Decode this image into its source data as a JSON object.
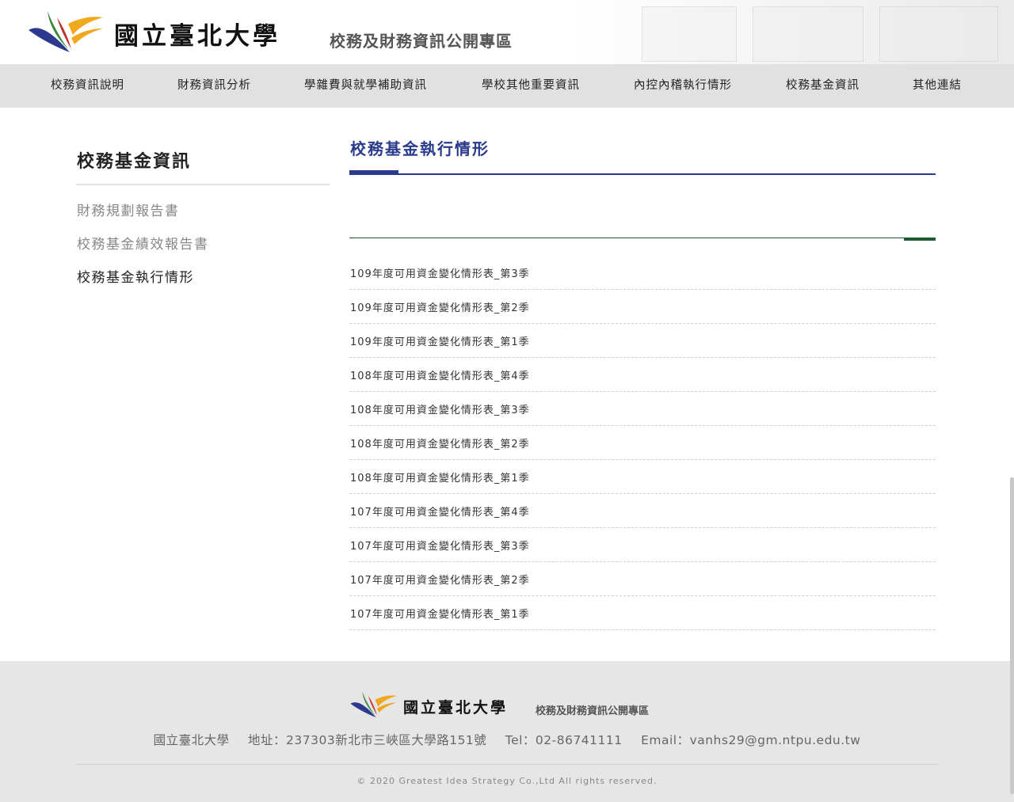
{
  "header": {
    "brand_name": "國立臺北大學",
    "brand_sub": "校務及財務資訊公開專區"
  },
  "nav": {
    "items": [
      {
        "label": "校務資訊說明"
      },
      {
        "label": "財務資訊分析"
      },
      {
        "label": "學雜費與就學補助資訊"
      },
      {
        "label": "學校其他重要資訊"
      },
      {
        "label": "內控內稽執行情形"
      },
      {
        "label": "校務基金資訊"
      },
      {
        "label": "其他連結"
      }
    ]
  },
  "sidebar": {
    "title": "校務基金資訊",
    "items": [
      {
        "label": "財務規劃報告書",
        "active": false
      },
      {
        "label": "校務基金績效報告書",
        "active": false
      },
      {
        "label": "校務基金執行情形",
        "active": true
      }
    ]
  },
  "main": {
    "title": "校務基金執行情形",
    "documents": [
      "109年度可用資金變化情形表_第3季",
      "109年度可用資金變化情形表_第2季",
      "109年度可用資金變化情形表_第1季",
      "108年度可用資金變化情形表_第4季",
      "108年度可用資金變化情形表_第3季",
      "108年度可用資金變化情形表_第2季",
      "108年度可用資金變化情形表_第1季",
      "107年度可用資金變化情形表_第4季",
      "107年度可用資金變化情形表_第3季",
      "107年度可用資金變化情形表_第2季",
      "107年度可用資金變化情形表_第1季"
    ]
  },
  "footer": {
    "brand_name": "國立臺北大學",
    "brand_sub": "校務及財務資訊公開專區",
    "school": "國立臺北大學",
    "address": "地址：237303新北市三峽區大學路151號",
    "tel": "Tel：02-86741111",
    "email": "Email：vanhs29@gm.ntpu.edu.tw",
    "copyright": "© 2020 Greatest Idea Strategy Co.,Ltd All rights reserved."
  },
  "colors": {
    "accent_blue": "#2a3a8c",
    "accent_green": "#1f5a32",
    "nav_bg": "#e1e1e1",
    "footer_bg": "#e6e6e6"
  }
}
